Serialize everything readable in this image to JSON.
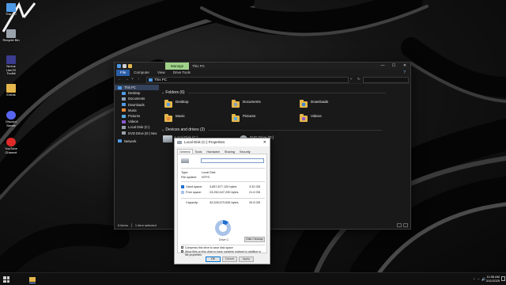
{
  "desktop": {
    "icons": [
      {
        "label": "This PC",
        "icon": "this-pc-icon",
        "color": "#4f9ae6"
      },
      {
        "label": "Recycle Bin",
        "icon": "recycle-bin-icon",
        "color": "#9aa3ab"
      },
      {
        "label": "Nexus LiteOS Toolkit",
        "icon": "toolkit-icon",
        "color": "#3b3b8f"
      },
      {
        "label": "Extras",
        "icon": "folder-icon",
        "color": "#e4b64c"
      },
      {
        "label": "Discord Server",
        "icon": "discord-icon",
        "color": "#5865f2"
      },
      {
        "label": "YouTube Channel",
        "icon": "youtube-icon",
        "color": "#e02a2a"
      }
    ],
    "brand_logo_icon": "nexus-logo-icon"
  },
  "explorer": {
    "manage_tab": "Manage",
    "title": "This PC",
    "ribbon_tabs": [
      "File",
      "Computer",
      "View",
      "Drive Tools"
    ],
    "address": "This PC",
    "controls": {
      "minimize": "—",
      "maximize": "☐",
      "close": "✕",
      "help": "?"
    },
    "nav_items": [
      {
        "label": "This PC",
        "selected": true,
        "color": "#4f9ae6"
      },
      {
        "label": "Desktop",
        "selected": false,
        "color": "#4f9ae6"
      },
      {
        "label": "Documents",
        "selected": false,
        "color": "#8aa0b8"
      },
      {
        "label": "Downloads",
        "selected": false,
        "color": "#4f9ae6"
      },
      {
        "label": "Music",
        "selected": false,
        "color": "#e58a3a"
      },
      {
        "label": "Pictures",
        "selected": false,
        "color": "#5aa8e0"
      },
      {
        "label": "Videos",
        "selected": false,
        "color": "#8a5ad0"
      },
      {
        "label": "Local Disk (C:)",
        "selected": false,
        "color": "#9aa3ab"
      },
      {
        "label": "DVD Drive (D:) Nex",
        "selected": false,
        "color": "#9aa3ab"
      },
      {
        "label": "Network",
        "selected": false,
        "color": "#4f9ae6"
      }
    ],
    "folders_header": "Folders (6)",
    "folders": [
      {
        "name": "Desktop",
        "badge_color": "#4f9ae6"
      },
      {
        "name": "Documents",
        "badge_color": "#8aa0b8"
      },
      {
        "name": "Downloads",
        "badge_color": "#3b86d9"
      },
      {
        "name": "Music",
        "badge_color": "#e58a3a"
      },
      {
        "name": "Pictures",
        "badge_color": "#5aa8e0"
      },
      {
        "name": "Videos",
        "badge_color": "#8a5ad0"
      }
    ],
    "drives_header": "Devices and drives (2)",
    "drives": [
      {
        "name": "Local Disk (C:)"
      },
      {
        "name": "DVD Drive (D:)",
        "sub": "Nexus"
      }
    ],
    "status": {
      "items": "6 items",
      "selected": "1 item selected"
    }
  },
  "properties": {
    "title": "Local Disk (C:) Properties",
    "close": "✕",
    "tabs": [
      "General",
      "Tools",
      "Hardware",
      "Sharing",
      "Security"
    ],
    "active_tab": "General",
    "type_label": "Type:",
    "type_value": "Local Disk",
    "fs_label": "File system:",
    "fs_value": "NTFS",
    "used_label": "Used space:",
    "used_bytes": "3,657,877,120 bytes",
    "used_gb": "3.32 GB",
    "free_label": "Free space:",
    "free_bytes": "23,250,047,230 bytes",
    "free_gb": "21.6 GB",
    "capacity_label": "Capacity:",
    "capacity_bytes": "32,028,073,536 bytes",
    "capacity_gb": "29.8 GB",
    "drive_label": "Drive C:",
    "cleanup_button": "Disk Cleanup",
    "compress_label": "Compress this drive to save disk space",
    "index_label": "Allow files on this drive to have contents indexed in addition to file properties",
    "used_fraction": 0.12,
    "used_color": "#1e6fd1",
    "free_color": "#a9c3e8",
    "buttons": {
      "ok": "OK",
      "cancel": "Cancel",
      "apply": "Apply"
    }
  },
  "taskbar": {
    "time": "11:58 AM",
    "date": "3/11/2025",
    "tray_icons": [
      "^",
      "◔",
      "🔊"
    ]
  }
}
